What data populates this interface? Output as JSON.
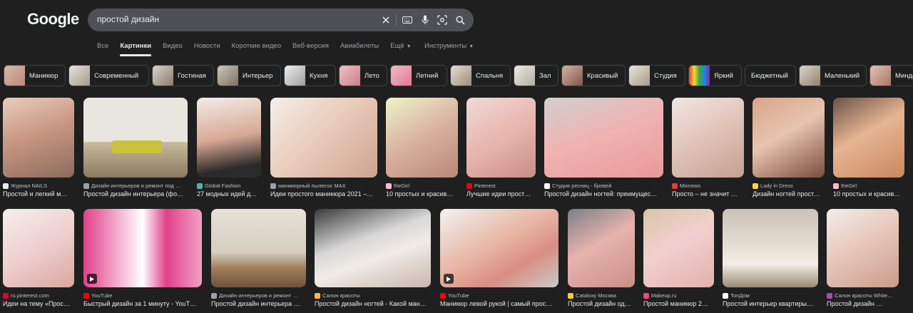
{
  "header": {
    "logo": "Google",
    "search_value": "простой дизайн"
  },
  "icons": {
    "clear": "close-icon",
    "keyboard": "keyboard-icon",
    "voice": "microphone-icon",
    "lens": "lens-icon",
    "search": "search-icon"
  },
  "tabs": [
    {
      "label": "Все"
    },
    {
      "label": "Картинки",
      "active": true
    },
    {
      "label": "Видео"
    },
    {
      "label": "Новости"
    },
    {
      "label": "Короткие видео"
    },
    {
      "label": "Веб-версия"
    },
    {
      "label": "Авиабилеты"
    },
    {
      "label": "Ещё"
    }
  ],
  "tools_label": "Инструменты",
  "chips": [
    {
      "label": "Маникюр"
    },
    {
      "label": "Современный"
    },
    {
      "label": "Гостиная"
    },
    {
      "label": "Интерьер"
    },
    {
      "label": "Кухня"
    },
    {
      "label": "Лето"
    },
    {
      "label": "Летний"
    },
    {
      "label": "Спальня"
    },
    {
      "label": "Зал"
    },
    {
      "label": "Красивый"
    },
    {
      "label": "Студия"
    },
    {
      "label": "Яркий"
    },
    {
      "label": "Бюджетный"
    },
    {
      "label": "Маленький"
    },
    {
      "label": "Минда"
    }
  ],
  "row1": [
    {
      "source": "Журнал NAILS",
      "title": "Простой и легкий м…"
    },
    {
      "source": "Дизайн интерьеров и ремонт под …",
      "title": "Простой дизайн интерьера (фо…"
    },
    {
      "source": "Global Fashion",
      "title": "27 модных идей д…"
    },
    {
      "source": "маникюрный пылесос MAX",
      "title": "Идеи простого маникюра 2021 –…"
    },
    {
      "source": "theGirl",
      "title": "10 простых и красив…"
    },
    {
      "source": "Pinterest",
      "title": "Лучшие идеи прост…"
    },
    {
      "source": "Студия ресниц - бровей",
      "title": "Простой дизайн ногтей: преимущес…"
    },
    {
      "source": "Mixnews",
      "title": "Просто – не значит …"
    },
    {
      "source": "Lady in Dress",
      "title": "Дизайн ногтей прост…"
    },
    {
      "source": "theGirl",
      "title": "10 простых и красив…"
    }
  ],
  "row2": [
    {
      "source": "ru.pinterest.com",
      "title": "Идеи на тему «Прос…"
    },
    {
      "source": "YouTube",
      "title": "Быстрый дизайн за 1 минуту - YouT…"
    },
    {
      "source": "Дизайн интерьеров и ремонт …",
      "title": "Простой дизайн интерьера …"
    },
    {
      "source": "Салон красоты",
      "title": "Простой дизайн ногтей - Какой ман…"
    },
    {
      "source": "YouTube",
      "title": "Маникюр левой рукой | самый прос…"
    },
    {
      "source": "Cataloxy Москва",
      "title": "Простой дизайн од…"
    },
    {
      "source": "Makeup.ru",
      "title": "Простой маникюр 2…"
    },
    {
      "source": "ТопДом",
      "title": "Простой интерьер квартиры…"
    },
    {
      "source": "Салон красоты White…",
      "title": "Простой дизайн …"
    }
  ]
}
